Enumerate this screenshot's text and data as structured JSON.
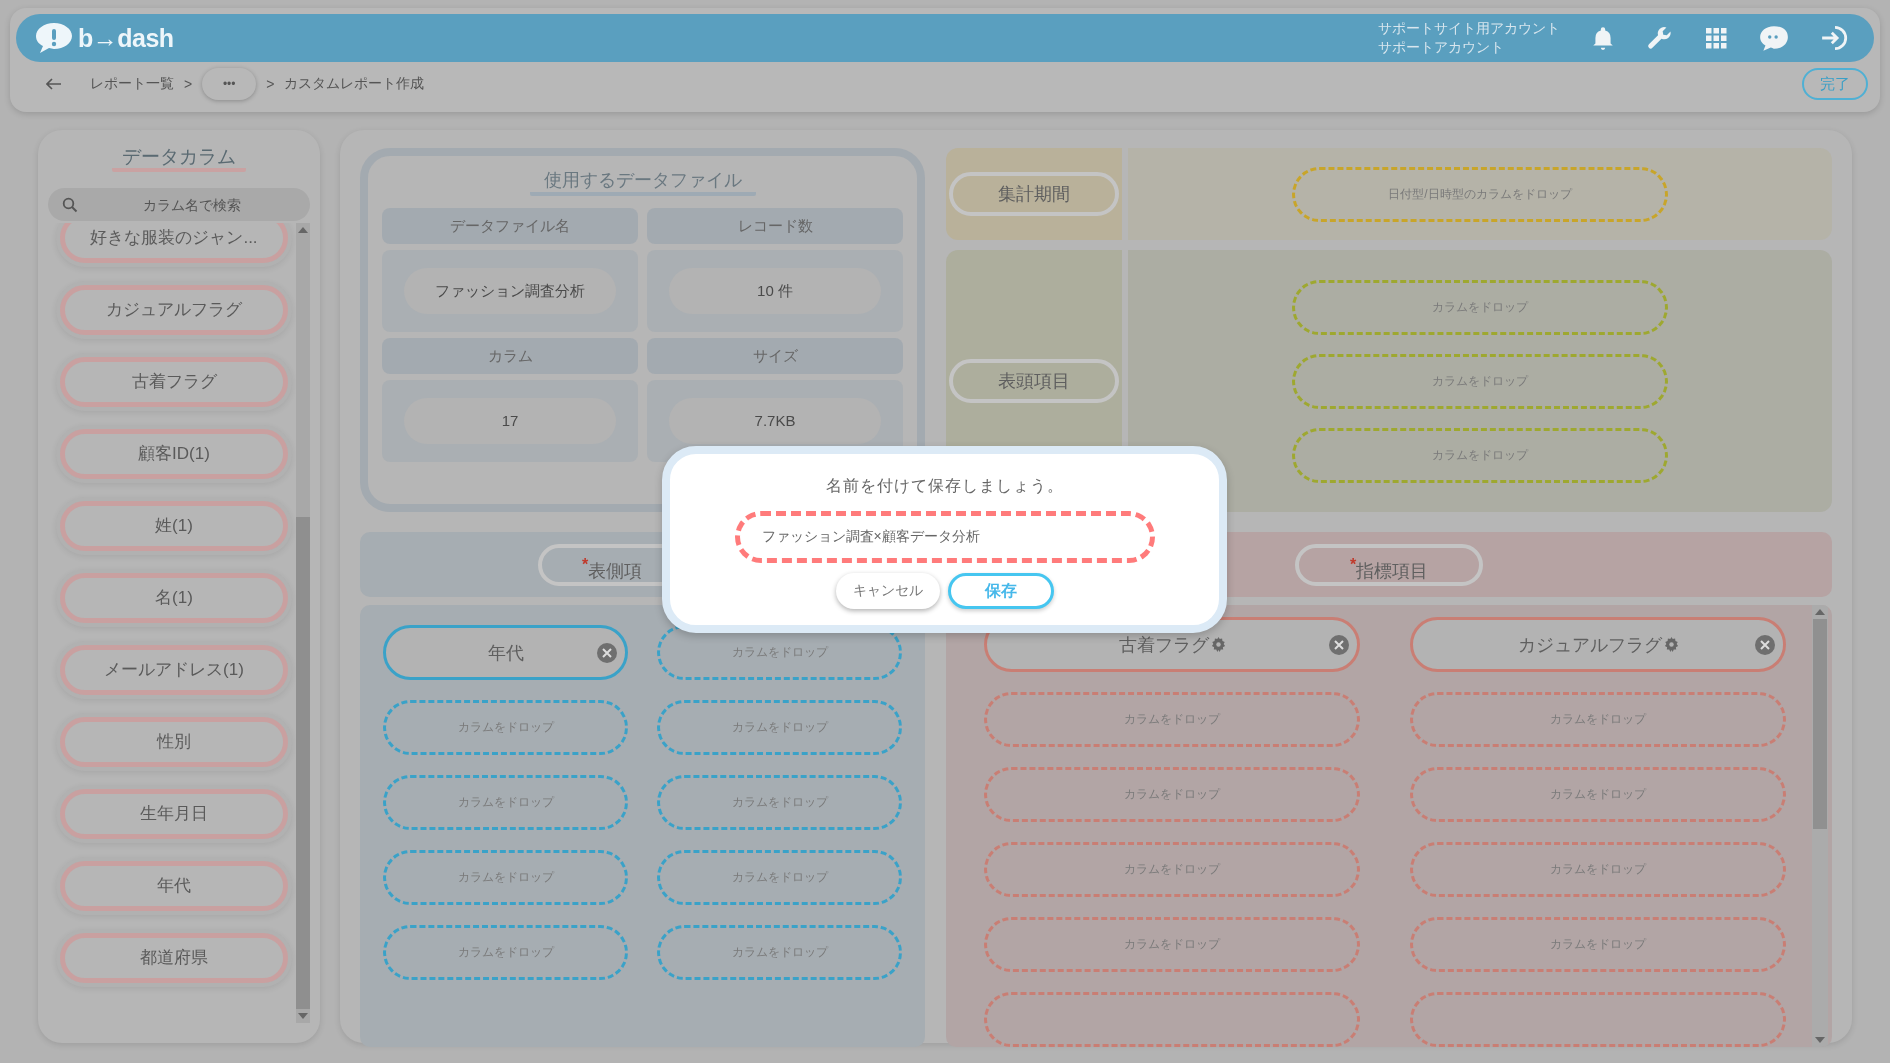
{
  "header": {
    "logo": "b→dash",
    "account_lines": [
      "サポートサイト用アカウント",
      "サポートアカウント"
    ]
  },
  "breadcrumb": {
    "separator": ">",
    "items": [
      {
        "kind": "link",
        "label": "レポート一覧"
      },
      {
        "kind": "more",
        "label": "•••"
      },
      {
        "kind": "current",
        "label": "カスタムレポート作成"
      }
    ]
  },
  "done_button": "完了",
  "sidebar": {
    "title": "データカラム",
    "search": {
      "placeholder": "カラム名で検索"
    },
    "columns": [
      "好きな服装のジャン...",
      "カジュアルフラグ",
      "古着フラグ",
      "顧客ID(1)",
      "姓(1)",
      "名(1)",
      "メールアドレス(1)",
      "性別",
      "生年月日",
      "年代",
      "都道府県"
    ]
  },
  "data_file": {
    "title": "使用するデータファイル",
    "fields": [
      {
        "label": "データファイル名",
        "value": "ファッション調査分析"
      },
      {
        "label": "レコード数",
        "value": "10 件"
      },
      {
        "label": "カラム",
        "value": "17"
      },
      {
        "label": "サイズ",
        "value": "7.7KB"
      }
    ]
  },
  "period": {
    "label": "集計期間",
    "slots": [
      "日付型/日時型のカラムをドロップ"
    ]
  },
  "header_items": {
    "label": "表頭項目",
    "slots": [
      "カラムをドロップ",
      "カラムをドロップ",
      "カラムをドロップ"
    ]
  },
  "row_items": {
    "label": "表側項",
    "required_mark": "*",
    "columns": [
      [
        {
          "kind": "column",
          "label": "年代",
          "settings": false
        },
        {
          "kind": "drop",
          "label": "カラムをドロップ"
        },
        {
          "kind": "drop",
          "label": "カラムをドロップ"
        },
        {
          "kind": "drop",
          "label": "カラムをドロップ"
        },
        {
          "kind": "drop",
          "label": "カラムをドロップ"
        }
      ],
      [
        {
          "kind": "drop",
          "label": "カラムをドロップ"
        },
        {
          "kind": "drop",
          "label": "カラムをドロップ"
        },
        {
          "kind": "drop",
          "label": "カラムをドロップ"
        },
        {
          "kind": "drop",
          "label": "カラムをドロップ"
        },
        {
          "kind": "drop",
          "label": "カラムをドロップ"
        }
      ]
    ]
  },
  "metrics": {
    "label": "指標項目",
    "required_mark": "*",
    "columns": [
      [
        {
          "kind": "column",
          "label": "古着フラグ",
          "settings": true
        },
        {
          "kind": "drop",
          "label": "カラムをドロップ"
        },
        {
          "kind": "drop",
          "label": "カラムをドロップ"
        },
        {
          "kind": "drop",
          "label": "カラムをドロップ"
        },
        {
          "kind": "drop",
          "label": "カラムをドロップ"
        },
        {
          "kind": "cut"
        }
      ],
      [
        {
          "kind": "column",
          "label": "カジュアルフラグ",
          "settings": true
        },
        {
          "kind": "drop",
          "label": "カラムをドロップ"
        },
        {
          "kind": "drop",
          "label": "カラムをドロップ"
        },
        {
          "kind": "drop",
          "label": "カラムをドロップ"
        },
        {
          "kind": "drop",
          "label": "カラムをドロップ"
        },
        {
          "kind": "cut"
        }
      ]
    ]
  },
  "dialog": {
    "message": "名前を付けて保存しましょう。",
    "name_field": {
      "value": "ファッション調査×顧客データ分析"
    },
    "buttons": [
      {
        "kind": "cancel",
        "label": "キャンセル"
      },
      {
        "kind": "save",
        "label": "保存"
      }
    ]
  }
}
